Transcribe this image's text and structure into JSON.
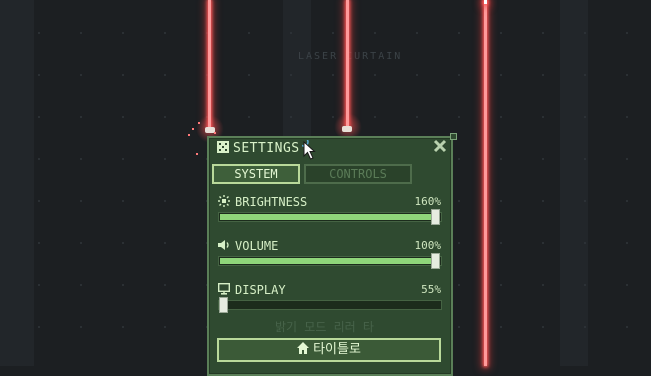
{
  "scene": {
    "background_label": "LASER CURTAIN",
    "hint_text": "밝기 모드 리러 타"
  },
  "settings_panel": {
    "title": "SETTINGS",
    "tabs": [
      {
        "label": "SYSTEM",
        "active": true
      },
      {
        "label": "CONTROLS",
        "active": false
      }
    ],
    "rows": [
      {
        "label": "BRIGHTNESS",
        "value_text": "160%",
        "level": 1.0
      },
      {
        "label": "VOLUME",
        "value_text": "100%",
        "level": 1.0
      },
      {
        "label": "DISPLAY",
        "value_text": "55%",
        "level": 0.0
      }
    ],
    "title_button_label": "타이틀로"
  },
  "colors": {
    "laser": "#ff5a5a",
    "panel_bg": "#2f4a30",
    "accent": "#8fd67a"
  },
  "icons": [
    "gear-icon",
    "close-icon",
    "sun-icon",
    "speaker-icon",
    "monitor-icon",
    "home-icon",
    "cursor-icon"
  ]
}
